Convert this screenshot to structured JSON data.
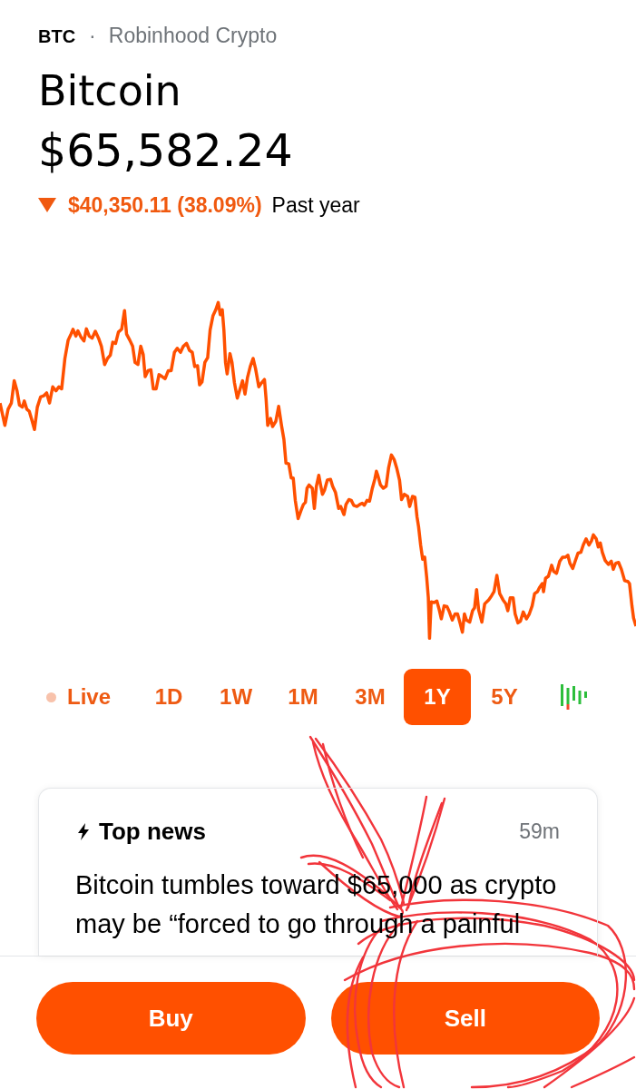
{
  "header": {
    "symbol": "BTC",
    "separator": "·",
    "source": "Robinhood Crypto",
    "name": "Bitcoin",
    "price": "$65,582.24",
    "change": {
      "down": true,
      "amount": "$40,350.11 (38.09%)",
      "period": "Past year"
    }
  },
  "ranges": [
    {
      "kind": "live",
      "label": "Live",
      "selected": false
    },
    {
      "kind": "period",
      "label": "1D",
      "selected": false
    },
    {
      "kind": "period",
      "label": "1W",
      "selected": false
    },
    {
      "kind": "period",
      "label": "1M",
      "selected": false
    },
    {
      "kind": "period",
      "label": "3M",
      "selected": false
    },
    {
      "kind": "period",
      "label": "1Y",
      "selected": true
    },
    {
      "kind": "period",
      "label": "5Y",
      "selected": false
    }
  ],
  "news": {
    "title": "Top news",
    "time": "59m",
    "headline": "Bitcoin tumbles toward $65,000 as crypto may be “forced to go through a painful"
  },
  "actions": [
    {
      "label": "Buy"
    },
    {
      "label": "Sell"
    }
  ]
}
